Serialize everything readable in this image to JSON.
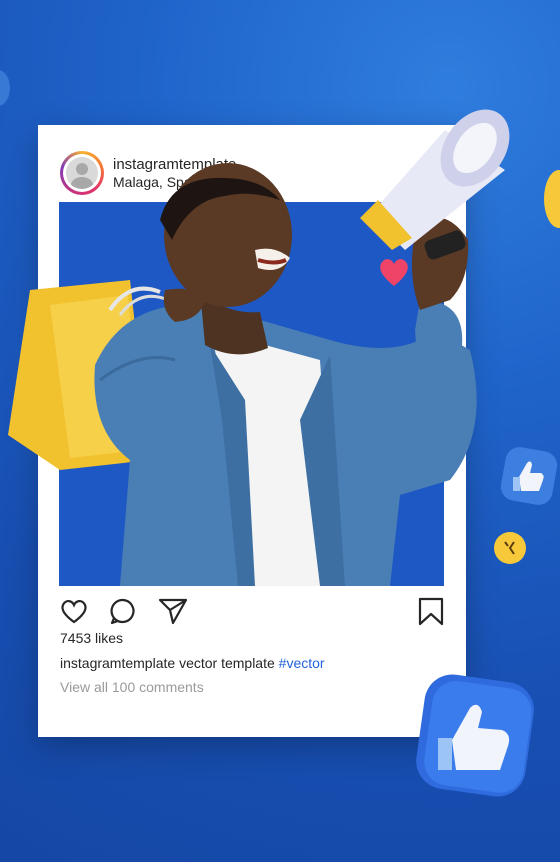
{
  "post": {
    "username": "instagramtemplate",
    "location": "Malaga, Spain",
    "likes": "7453 likes",
    "caption_user": "instagramtemplate",
    "caption_text": "vector template",
    "caption_tag": "#vector",
    "comments_link": "View all 100 comments"
  },
  "icons": [
    "heart-icon",
    "comment-icon",
    "share-icon",
    "bookmark-icon",
    "megaphone-icon",
    "thumbs-up-icon",
    "emoji-icon"
  ],
  "colors": {
    "background": "#1f63c9",
    "card": "#ffffff",
    "tag": "#2563d9",
    "muted": "#9a9a9a",
    "bag": "#f2c12e",
    "jacket": "#4a7fb6"
  }
}
